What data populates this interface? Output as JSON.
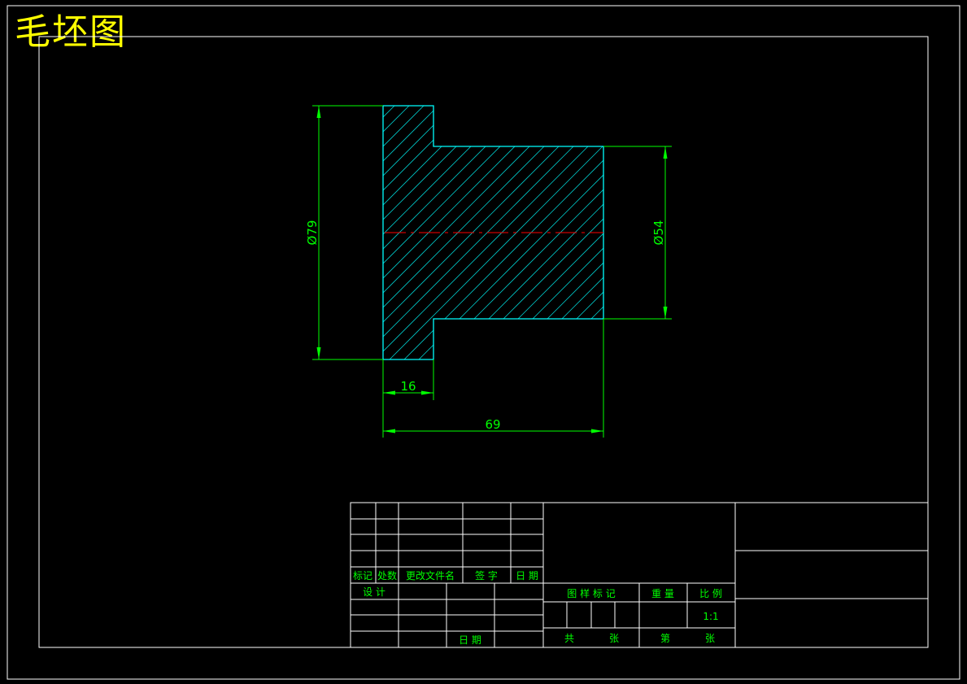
{
  "drawing": {
    "title": "毛坯图",
    "dimensions": {
      "outer_diameter": "Ø79",
      "inner_diameter": "Ø54",
      "flange_length": "16",
      "total_length": "69"
    }
  },
  "title_block": {
    "revision_headers": {
      "mark": "标记",
      "count": "处数",
      "document": "更改文件名",
      "signature": "签 字",
      "date": "日 期"
    },
    "design": "设 计",
    "date_label": "日 期",
    "stage_mark": "图 样 标 记",
    "weight": "重 量",
    "scale_label": "比 例",
    "scale_value": "1:1",
    "total": "共",
    "sheet": "张",
    "number": "第",
    "sheet2": "张"
  },
  "colors": {
    "border": "#ffffff",
    "title": "#ffff00",
    "dimension": "#00ff00",
    "outline": "#00ffff",
    "hatch": "#00c8c8",
    "centerline": "#ff0000",
    "label": "#00ff00"
  }
}
